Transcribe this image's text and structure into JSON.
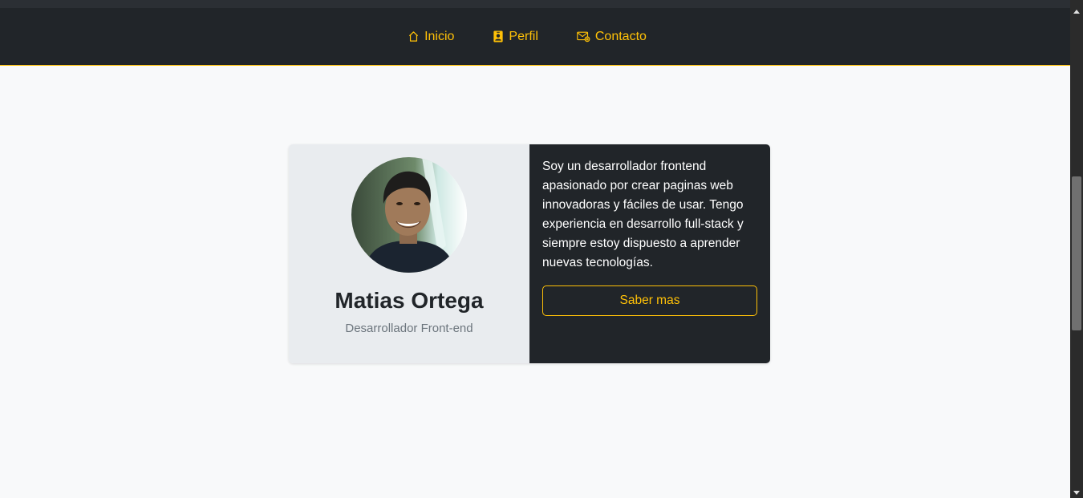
{
  "nav": {
    "items": [
      {
        "label": "Inicio",
        "icon": "home-icon"
      },
      {
        "label": "Perfil",
        "icon": "person-badge-icon"
      },
      {
        "label": "Contacto",
        "icon": "envelope-at-icon"
      }
    ],
    "accent_color": "#ffc107",
    "background_color": "#212529"
  },
  "profile": {
    "name": "Matias Ortega",
    "role": "Desarrollador Front-end",
    "bio": "Soy un desarrollador frontend apasionado por crear paginas web innovadoras y fáciles de usar. Tengo experiencia en desarrollo full-stack y siempre estoy dispuesto a aprender nuevas tecnologías.",
    "button_label": "Saber mas"
  }
}
